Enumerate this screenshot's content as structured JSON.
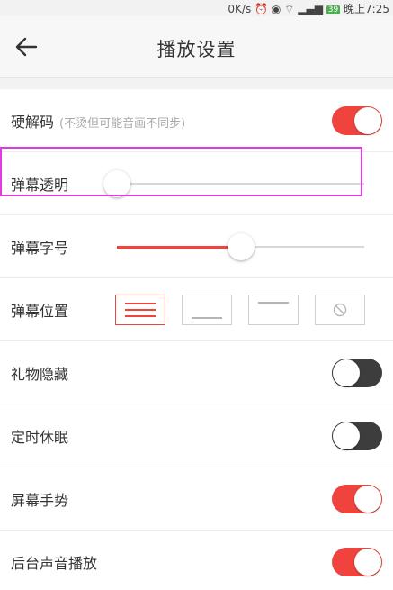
{
  "status_bar": {
    "network_speed": "0K/s",
    "battery_level": "39",
    "time": "晚上7:25"
  },
  "nav": {
    "title": "播放设置"
  },
  "settings": {
    "hardware_decode": {
      "label": "硬解码",
      "hint": "(不烫但可能音画不同步)",
      "enabled": true
    },
    "danmaku_opacity": {
      "label": "弹幕透明",
      "value": 0.0
    },
    "danmaku_font_size": {
      "label": "弹幕字号",
      "value": 0.5
    },
    "danmaku_position": {
      "label": "弹幕位置",
      "options": [
        "scroll",
        "bottom",
        "top",
        "off"
      ],
      "selected": "scroll"
    },
    "gift_hide": {
      "label": "礼物隐藏",
      "enabled": false
    },
    "sleep_timer": {
      "label": "定时休眠",
      "enabled": false
    },
    "screen_gesture": {
      "label": "屏幕手势",
      "enabled": true
    },
    "background_audio": {
      "label": "后台声音播放",
      "enabled": true
    }
  },
  "colors": {
    "accent": "#f0433e",
    "toggle_off": "#3d3d3d",
    "highlight": "#e03be0"
  }
}
